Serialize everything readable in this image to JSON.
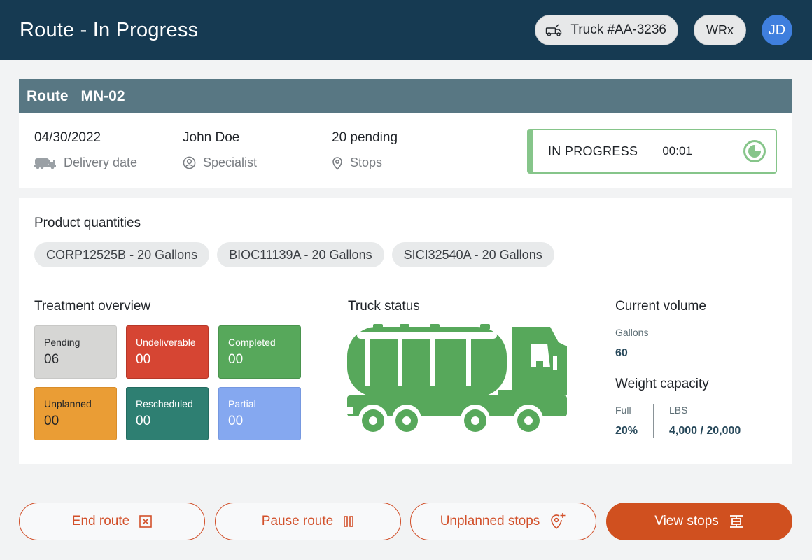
{
  "header": {
    "title": "Route - In Progress",
    "truck_label": "Truck #AA-3236",
    "org_label": "WRx",
    "avatar_initials": "JD",
    "background_color": "#163a52"
  },
  "route": {
    "label": "Route",
    "code": "MN-02",
    "delivery_date": "04/30/2022",
    "delivery_date_label": "Delivery date",
    "specialist_name": "John Doe",
    "specialist_label": "Specialist",
    "stops_value": "20 pending",
    "stops_label": "Stops",
    "status_text": "IN PROGRESS",
    "status_timer": "00:01",
    "status_color": "#86c58a"
  },
  "products": {
    "title": "Product quantities",
    "items": [
      "CORP12525B - 20 Gallons",
      "BIOC11139A - 20 Gallons",
      "SICI32540A - 20 Gallons"
    ]
  },
  "treatment": {
    "title": "Treatment overview",
    "tiles": [
      {
        "label": "Pending",
        "value": "06",
        "color": "#d6d6d4"
      },
      {
        "label": "Undeliverable",
        "value": "00",
        "color": "#d64533"
      },
      {
        "label": "Completed",
        "value": "00",
        "color": "#57a85b"
      },
      {
        "label": "Unplanned",
        "value": "00",
        "color": "#ea9d35"
      },
      {
        "label": "Rescheduled",
        "value": "00",
        "color": "#2e7f72"
      },
      {
        "label": "Partial",
        "value": "00",
        "color": "#85a8f0"
      }
    ]
  },
  "truck_status": {
    "title": "Truck status",
    "fill_color": "#57a85b"
  },
  "volume": {
    "title": "Current volume",
    "unit_label": "Gallons",
    "value": "60"
  },
  "weight": {
    "title": "Weight capacity",
    "full_label": "Full",
    "full_value": "20%",
    "lbs_label": "LBS",
    "lbs_value": "4,000 / 20,000"
  },
  "actions": {
    "end_route": "End route",
    "pause_route": "Pause route",
    "unplanned_stops": "Unplanned stops",
    "view_stops": "View stops",
    "accent_color": "#d0501f"
  }
}
